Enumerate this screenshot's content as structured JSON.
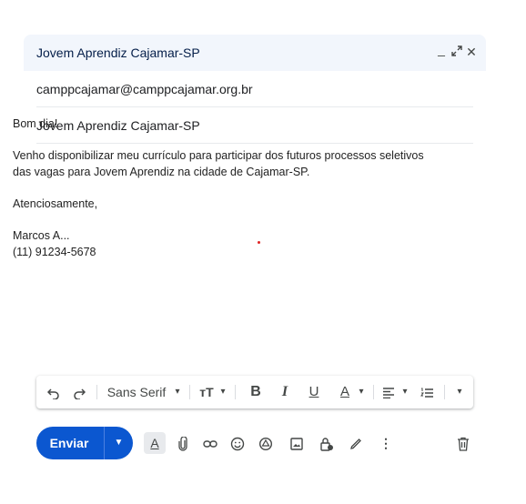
{
  "window": {
    "title": "Jovem Aprendiz Cajamar-SP"
  },
  "titlebar_controls": {
    "minimize": "_",
    "popout": "⤢",
    "close": "✕"
  },
  "to": {
    "value": "camppcajamar@camppcajamar.org.br"
  },
  "subject": {
    "value": "Jovem Aprendiz Cajamar-SP"
  },
  "message": {
    "greeting": "Bom dia!",
    "line1": "Venho disponibilizar meu currículo para participar dos futuros processos seletivos",
    "line2": "das vagas para Jovem Aprendiz na cidade de Cajamar-SP.",
    "closing": "Atenciosamente,",
    "name": "Marcos A...",
    "phone": "(11) 91234-5678"
  },
  "format_toolbar": {
    "font": "Sans Serif",
    "icons": [
      "undo-icon",
      "redo-icon",
      "font-size-icon",
      "bold-icon",
      "italic-icon",
      "underline-icon",
      "text-color-icon",
      "align-icon",
      "numbered-list-icon",
      "more-formatting-icon"
    ]
  },
  "send": {
    "label": "Enviar"
  },
  "colors": {
    "accent": "#0b57d0",
    "header_bg": "#f2f6fc"
  }
}
